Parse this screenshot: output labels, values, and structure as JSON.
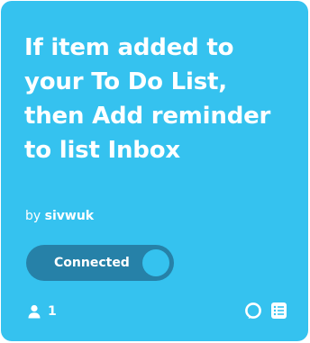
{
  "card": {
    "title": "If item added to your To Do List, then Add reminder to list Inbox",
    "author_prefix": "by",
    "author_name": "sivwuk",
    "toggle_label": "Connected",
    "user_count": "1",
    "colors": {
      "card_background": "#35c2ef",
      "toggle_background": "#2681a8",
      "text": "#ffffff"
    },
    "icons": [
      "user-icon",
      "alexa-icon",
      "reminders-icon"
    ]
  }
}
